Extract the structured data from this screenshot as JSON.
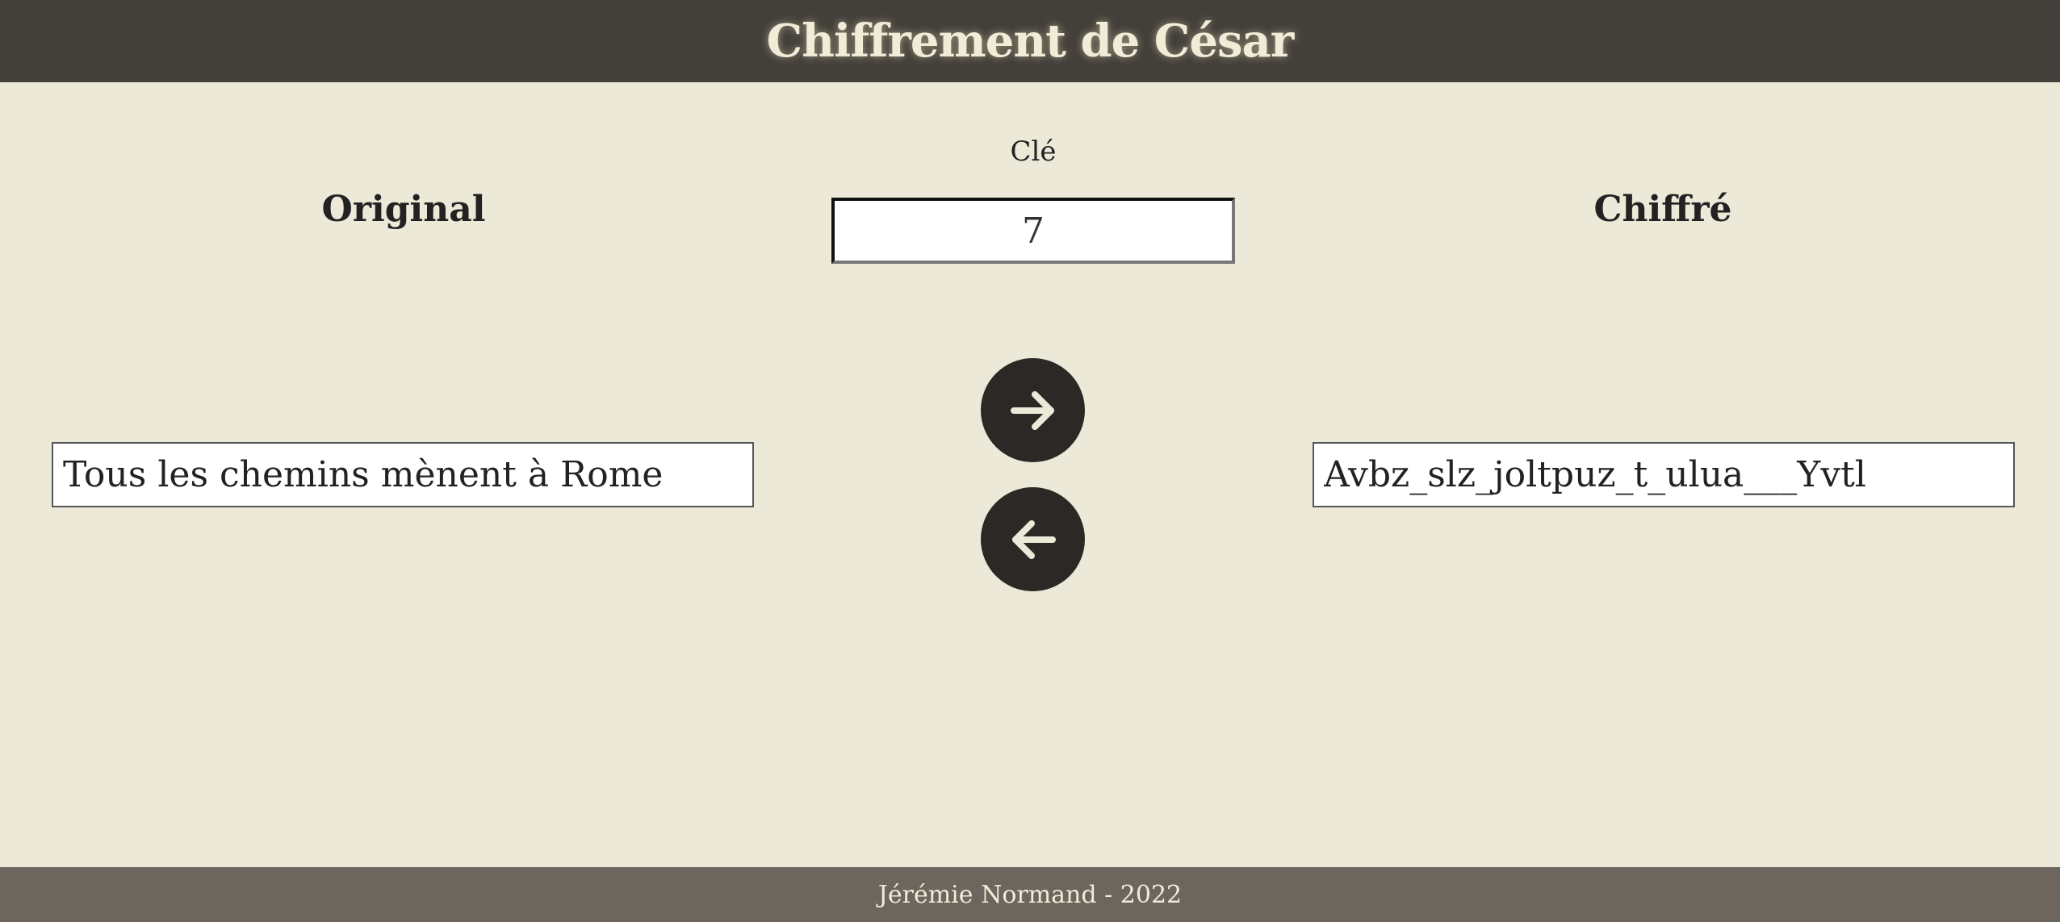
{
  "header": {
    "title": "Chiffrement de César"
  },
  "labels": {
    "original": "Original",
    "key": "Clé",
    "encrypted": "Chiffré"
  },
  "inputs": {
    "key_value": "7",
    "original_value": "Tous les chemins mènent à Rome",
    "encrypted_value": "Avbz_slz_joltpuz_t_ulua___Yvtl"
  },
  "buttons": {
    "encrypt_icon": "arrow-right-icon",
    "decrypt_icon": "arrow-left-icon"
  },
  "footer": {
    "text": "Jérémie Normand - 2022"
  },
  "colors": {
    "header_bg": "#433f3a",
    "page_bg": "#ece9d8",
    "button_bg": "#2b2925",
    "footer_bg": "#6d665f",
    "title_color": "#f1ecd7"
  }
}
